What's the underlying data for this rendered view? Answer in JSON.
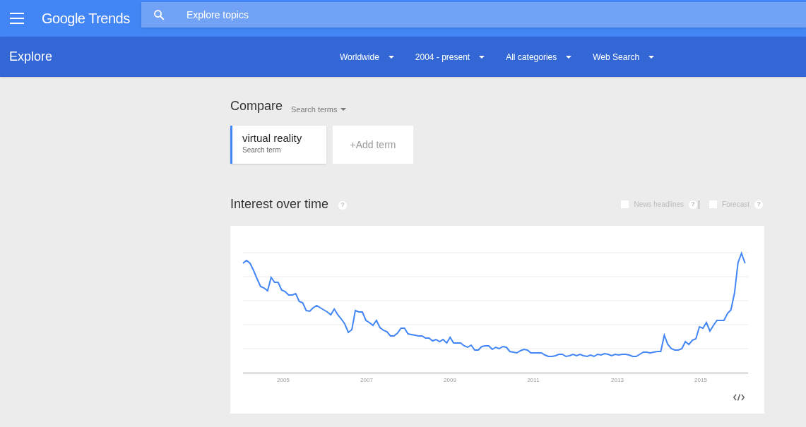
{
  "app": {
    "title": "Google Trends"
  },
  "search": {
    "placeholder": "Explore topics"
  },
  "page_title": "Explore",
  "filters": [
    {
      "label": "Worldwide"
    },
    {
      "label": "2004 - present"
    },
    {
      "label": "All categories"
    },
    {
      "label": "Web Search"
    }
  ],
  "compare": {
    "title": "Compare",
    "mode": "Search terms",
    "terms": [
      {
        "term": "virtual reality",
        "type": "Search term"
      }
    ],
    "add_label": "+Add term"
  },
  "interest": {
    "title": "Interest over time",
    "help": "?",
    "options": [
      {
        "label": "News headlines",
        "checked": false,
        "help": "?"
      },
      {
        "label": "Forecast",
        "checked": false,
        "help": "?"
      }
    ],
    "x_labels": [
      "2005",
      "2007",
      "2009",
      "2011",
      "2013",
      "2015"
    ]
  }
}
